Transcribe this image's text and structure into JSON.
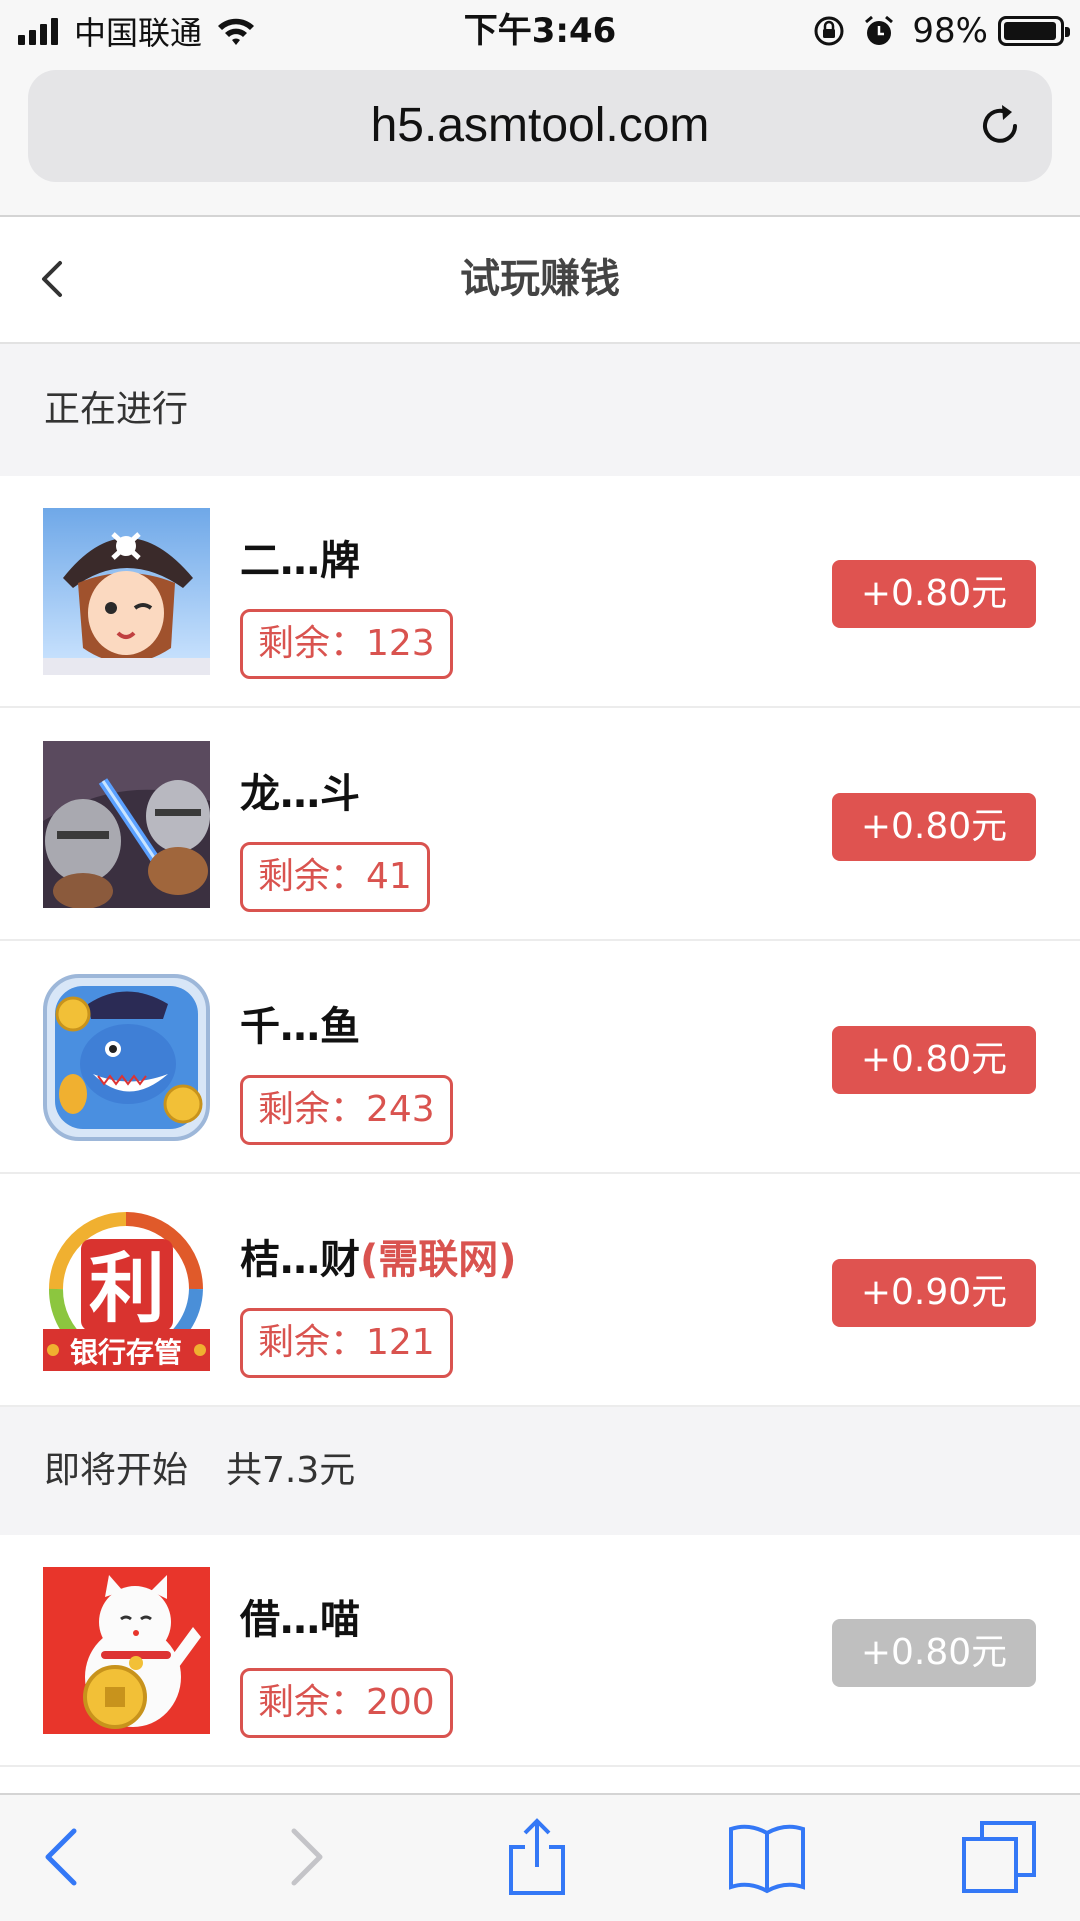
{
  "status_bar": {
    "carrier": "中国联通",
    "time": "下午3:46",
    "battery": "98%"
  },
  "browser": {
    "url": "h5.asmtool.com"
  },
  "header": {
    "title": "试玩赚钱"
  },
  "sections": {
    "ongoing": {
      "title": "正在进行"
    },
    "upcoming": {
      "title": "即将开始",
      "total": "共7.3元"
    }
  },
  "items": [
    {
      "name": "二…牌",
      "note": "",
      "remaining": "剩余：123",
      "reward": "+0.80元",
      "icon": "pirate-girl-game-icon",
      "enabled": true
    },
    {
      "name": "龙…斗",
      "note": "",
      "remaining": "剩余：41",
      "reward": "+0.80元",
      "icon": "knight-battle-game-icon",
      "enabled": true
    },
    {
      "name": "千…鱼",
      "note": "",
      "remaining": "剩余：243",
      "reward": "+0.80元",
      "icon": "fishing-shark-game-icon",
      "enabled": true
    },
    {
      "name": "桔…财",
      "note": "(需联网)",
      "remaining": "剩余：121",
      "reward": "+0.90元",
      "icon": "bank-finance-app-icon",
      "icon_text_main": "利",
      "icon_text_banner": "银行存管",
      "enabled": true
    },
    {
      "name": "借…喵",
      "note": "",
      "remaining": "剩余：200",
      "reward": "+0.80元",
      "icon": "lucky-cat-loan-app-icon",
      "enabled": false
    }
  ],
  "colors": {
    "accent": "#df5350",
    "disabled": "#bfbfbf",
    "ios_blue": "#3478f6",
    "section_bg": "#f4f4f6"
  }
}
